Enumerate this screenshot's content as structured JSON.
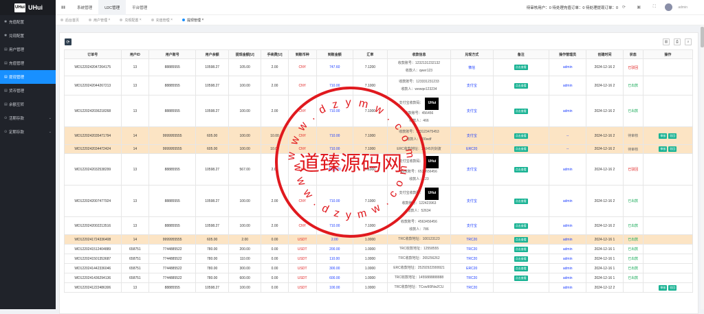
{
  "app": {
    "logo_mark": "UHui",
    "logo_text": "UHui"
  },
  "sidebar": {
    "items": [
      {
        "label": "充值配置",
        "icon": "gear-icon",
        "active": false
      },
      {
        "label": "兑现配置",
        "icon": "gear-icon",
        "active": false
      },
      {
        "label": "用户管理",
        "icon": "user-icon",
        "active": false
      },
      {
        "label": "充值管理",
        "icon": "list-icon",
        "active": false
      },
      {
        "label": "提现管理",
        "icon": "list-icon",
        "active": true
      },
      {
        "label": "货币管理",
        "icon": "coin-icon",
        "active": false
      },
      {
        "label": "余额互转",
        "icon": "transfer-icon",
        "active": false
      },
      {
        "label": "活期存款",
        "icon": "deposit-icon",
        "active": false
      },
      {
        "label": "定期存款",
        "icon": "deposit-icon",
        "active": false
      }
    ]
  },
  "topbar": {
    "menus": [
      "系统管理",
      "U2C管理",
      "平台管理"
    ],
    "stats": "待审核用户：0  待处理充值订单：0  待处理提现订单：0",
    "username": "admin"
  },
  "tabs": [
    "后台首页",
    "用户管理",
    "兑现配置",
    "充值管理",
    "提现管理"
  ],
  "table": {
    "headers": [
      "订单号",
      "用户ID",
      "用户账号",
      "用户余额",
      "提现金额[U]",
      "手续费[U]",
      "到账币种",
      "到账金额",
      "汇率",
      "收款信息",
      "兑现方式",
      "备注",
      "操作管理员",
      "创建时间",
      "状态",
      "操作"
    ],
    "view_label": "点击查看",
    "row_actions": [
      "审核",
      "驳回"
    ],
    "rows": [
      {
        "order": "WD1220242047264175",
        "uid": "13",
        "account": "88885555",
        "balance": "10598.27",
        "amount": "105.00",
        "fee": "2.00",
        "currency": "CNY",
        "arrive": "747.60",
        "rate": "7.1200",
        "info": [
          "收款账号：1232131232132",
          "收款人：qwer123"
        ],
        "qr": false,
        "method": "微信",
        "admin": "admin",
        "time": "2024-12-16 2",
        "status": "已驳回",
        "status_color": "red",
        "actions": false,
        "sel": false
      },
      {
        "order": "WD1220242044267213",
        "uid": "13",
        "account": "88885555",
        "balance": "10598.27",
        "amount": "100.00",
        "fee": "2.00",
        "currency": "CNY",
        "arrive": "710.00",
        "rate": "7.1000",
        "info": [
          "收款账号：123331231233",
          "收款人：wewqe123234"
        ],
        "qr": false,
        "method": "支付宝",
        "admin": "admin",
        "time": "2024-12-16 2",
        "status": "已出款",
        "status_color": "green",
        "actions": false,
        "sel": false
      },
      {
        "order": "WD1220242036218268",
        "uid": "13",
        "account": "88885555",
        "balance": "10598.27",
        "amount": "100.00",
        "fee": "2.00",
        "currency": "CNY",
        "arrive": "710.00",
        "rate": "7.1000",
        "info": [
          "收款账号：456456",
          "收款人：466"
        ],
        "qr": true,
        "qr_label": "支付宝收款码：",
        "method": "支付宝",
        "admin": "admin",
        "time": "2024-12-16 2",
        "status": "已出款",
        "status_color": "green",
        "actions": false,
        "sel": false
      },
      {
        "order": "WD1220242035471794",
        "uid": "14",
        "account": "9999955555",
        "balance": "605.00",
        "amount": "100.00",
        "fee": "10.00",
        "currency": "CNY",
        "arrive": "710.00",
        "rate": "7.1000",
        "info": [
          "收款账号：123123475453",
          "收款人：100wdf"
        ],
        "qr": false,
        "method": "支付宝",
        "admin": "--",
        "time": "2024-12-16 2",
        "status": "待审核",
        "status_color": "gray",
        "actions": true,
        "sel": true
      },
      {
        "order": "WD1220242034472424",
        "uid": "14",
        "account": "9999955555",
        "balance": "605.00",
        "amount": "100.00",
        "fee": "10.00",
        "currency": "CNY",
        "arrive": "710.00",
        "rate": "7.1000",
        "info": [
          "ERC收款地址：10045刘剑波"
        ],
        "qr": false,
        "method": "ERC20",
        "admin": "--",
        "time": "2024-12-16 2",
        "status": "待审核",
        "status_color": "gray",
        "actions": true,
        "sel": true
      },
      {
        "order": "WD1220242032538299",
        "uid": "13",
        "account": "88885555",
        "balance": "10598.27",
        "amount": "567.00",
        "fee": "2.00",
        "currency": "CNY",
        "arrive": "4025.70",
        "rate": "7.1000",
        "info": [
          "收款账号：6534656456",
          "收款人：123"
        ],
        "qr": true,
        "qr_label": "支付宝收款码：",
        "method": "支付宝",
        "admin": "admin",
        "time": "2024-12-16 2",
        "status": "已驳回",
        "status_color": "red",
        "actions": false,
        "sel": false
      },
      {
        "order": "WD1220242007477924",
        "uid": "13",
        "account": "88885555",
        "balance": "10598.27",
        "amount": "100.00",
        "fee": "2.00",
        "currency": "CNY",
        "arrive": "710.00",
        "rate": "7.1000",
        "info": [
          "收款账号：122423963",
          "收款人：52634"
        ],
        "qr": true,
        "qr_label": "支付宝收款码：",
        "method": "支付宝",
        "admin": "admin",
        "time": "2024-12-16 2",
        "status": "已出款",
        "status_color": "green",
        "actions": false,
        "sel": false
      },
      {
        "order": "WD1220242002213516",
        "uid": "13",
        "account": "88885555",
        "balance": "10598.27",
        "amount": "100.00",
        "fee": "2.00",
        "currency": "CNY",
        "arrive": "710.00",
        "rate": "7.1000",
        "info": [
          "收款账号：4563456456",
          "收款人：786"
        ],
        "qr": false,
        "method": "支付宝",
        "admin": "admin",
        "time": "2024-12-16 2",
        "status": "已出款",
        "status_color": "green",
        "actions": false,
        "sel": false
      },
      {
        "order": "WD1220241724336408",
        "uid": "14",
        "account": "9999955555",
        "balance": "605.00",
        "amount": "2.00",
        "fee": "0.00",
        "currency": "USDT",
        "arrive": "2.00",
        "rate": "1.0000",
        "info": [
          "TRC收款地址：100123123"
        ],
        "qr": false,
        "method": "TRC20",
        "admin": "admin",
        "time": "2024-12-16 1",
        "status": "已出款",
        "status_color": "green",
        "actions": false,
        "sel": true
      },
      {
        "order": "WD1220241512404889",
        "uid": "658751",
        "account": "7744885522",
        "balance": "780.00",
        "amount": "200.00",
        "fee": "0.00",
        "currency": "USDT",
        "arrive": "200.00",
        "rate": "1.0000",
        "info": [
          "TRC收款地址：12558555"
        ],
        "qr": false,
        "method": "TRC20",
        "admin": "admin",
        "time": "2024-12-16 1",
        "status": "已出款",
        "status_color": "green",
        "actions": false,
        "sel": false
      },
      {
        "order": "WD1220241501353687",
        "uid": "658751",
        "account": "7744885522",
        "balance": "780.00",
        "amount": "110.00",
        "fee": "0.00",
        "currency": "USDT",
        "arrive": "110.00",
        "rate": "1.0000",
        "info": [
          "TRC收款地址：265256262"
        ],
        "qr": false,
        "method": "TRC20",
        "admin": "admin",
        "time": "2024-12-16 1",
        "status": "已出款",
        "status_color": "green",
        "actions": false,
        "sel": false
      },
      {
        "order": "WD1220241442336046",
        "uid": "658751",
        "account": "7744885522",
        "balance": "780.00",
        "amount": "300.00",
        "fee": "0.00",
        "currency": "USDT",
        "arrive": "300.00",
        "rate": "1.0000",
        "info": [
          "ERC收款地址：25292922999921"
        ],
        "qr": false,
        "method": "ERC20",
        "admin": "admin",
        "time": "2024-12-16 1",
        "status": "已出款",
        "status_color": "green",
        "actions": false,
        "sel": false
      },
      {
        "order": "WD1220241436294136",
        "uid": "658751",
        "account": "7744885522",
        "balance": "780.00",
        "amount": "600.00",
        "fee": "0.00",
        "currency": "USDT",
        "arrive": "600.00",
        "rate": "1.0000",
        "info": [
          "TRC收款地址：1455888888888"
        ],
        "qr": false,
        "method": "TRC20",
        "admin": "admin",
        "time": "2024-12-16 1",
        "status": "已出款",
        "status_color": "green",
        "actions": false,
        "sel": false
      },
      {
        "order": "WD1220241222486306",
        "uid": "13",
        "account": "88885555",
        "balance": "10598.27",
        "amount": "100.00",
        "fee": "0.00",
        "currency": "USDT",
        "arrive": "100.00",
        "rate": "1.0000",
        "info": [
          "TRC收款地址：TCxw90lNw2CU"
        ],
        "qr": false,
        "method": "TRC20",
        "admin": "admin",
        "time": "2024-12-12 2",
        "status": "",
        "status_color": "gray",
        "actions": true,
        "sel": false
      }
    ]
  },
  "watermark": {
    "title": "道臻源码网",
    "arc_text": "w w w . d z y m w . c o m",
    "color": "#e0191e"
  }
}
